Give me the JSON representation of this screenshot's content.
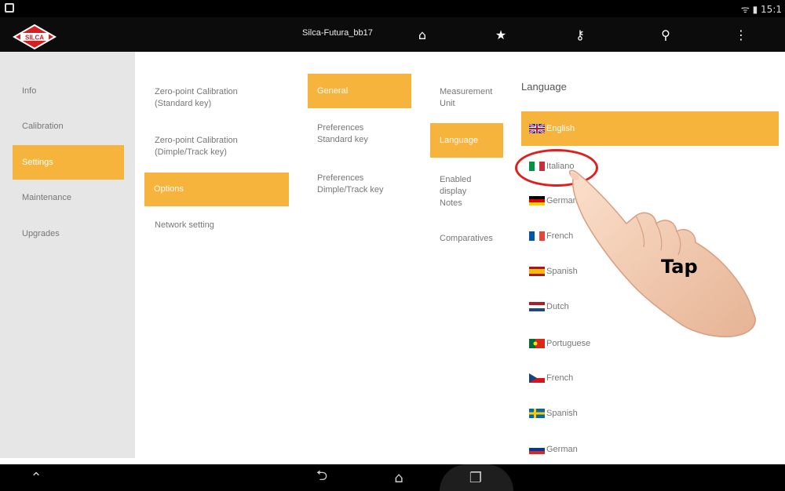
{
  "statusbar": {
    "right_text": "ᯤ ▮ 15:1"
  },
  "actionbar": {
    "title": "Silca-Futura_bb17",
    "icons": [
      "home-icon",
      "star-icon",
      "key-icon",
      "search-icon",
      "overflow-menu-icon"
    ],
    "icon_glyphs": {
      "home": "⌂",
      "star": "★",
      "key": "⚷",
      "search": "⚲",
      "menu": "⋮"
    }
  },
  "logo_text": "SILCA",
  "sidebar": {
    "items": [
      {
        "label": "Info",
        "active": false
      },
      {
        "label": "Calibration",
        "active": false
      },
      {
        "label": "Settings",
        "active": true
      },
      {
        "label": "Maintenance",
        "active": false
      },
      {
        "label": "Upgrades",
        "active": false
      }
    ]
  },
  "column2": {
    "items": [
      {
        "label": "Zero-point Calibration\n(Standard key)"
      },
      {
        "label": "Zero-point Calibration\n(Dimple/Track key)"
      },
      {
        "label": "Options",
        "active": true
      },
      {
        "label": "Network setting"
      }
    ]
  },
  "column3": {
    "items": [
      {
        "label": "General",
        "active": true
      },
      {
        "label": "Preferences\nStandard key"
      },
      {
        "label": "Preferences\nDimple/Track key"
      }
    ]
  },
  "column4": {
    "items": [
      {
        "label": "Measurement\nUnit"
      },
      {
        "label": "Language",
        "active": true
      },
      {
        "label": "Enabled\ndisplay\nNotes"
      },
      {
        "label": "Comparatives"
      }
    ]
  },
  "language": {
    "title": "Language",
    "options": [
      {
        "label": "English",
        "flag": "uk",
        "selected": true
      },
      {
        "label": "Italiano",
        "flag": "it"
      },
      {
        "label": "German",
        "flag": "de"
      },
      {
        "label": "French",
        "flag": "fr"
      },
      {
        "label": "Spanish",
        "flag": "es"
      },
      {
        "label": "Dutch",
        "flag": "nl"
      },
      {
        "label": "Portuguese",
        "flag": "pt"
      },
      {
        "label": "French",
        "flag": "cz"
      },
      {
        "label": "Spanish",
        "flag": "se"
      },
      {
        "label": "German",
        "flag": "ru"
      }
    ]
  },
  "overlay": {
    "tap_label": "Tap"
  },
  "navbar": {
    "back": "⮌",
    "home": "⌂",
    "recents": "❐",
    "left": "⌃"
  },
  "colors": {
    "accent": "#f6b43c",
    "highlight_circle": "#e01e1e",
    "sidebar_bg": "#e6e6e6"
  }
}
